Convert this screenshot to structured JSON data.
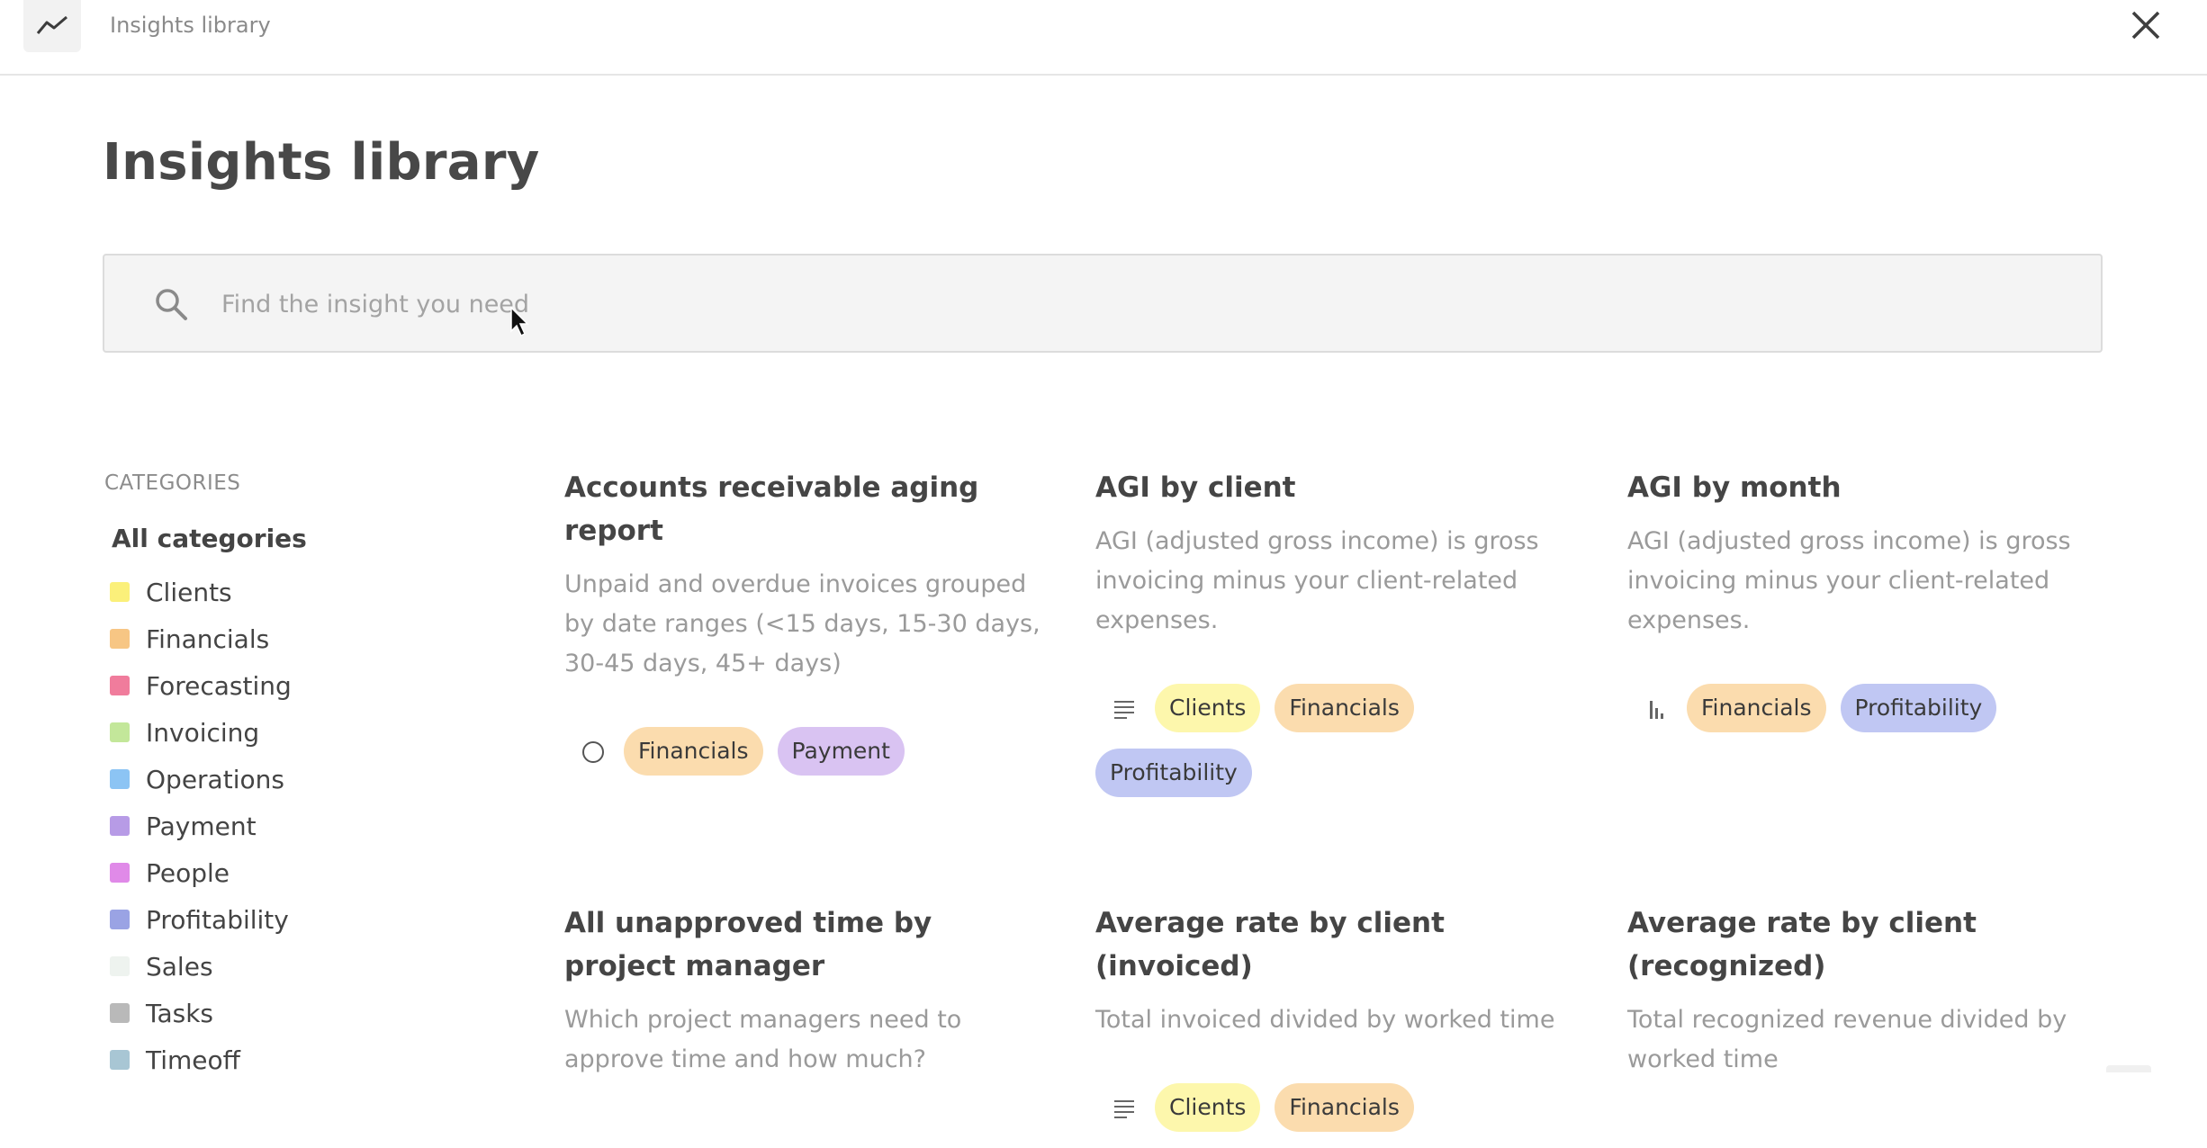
{
  "topbar": {
    "title": "Insights library",
    "app_icon": "trend-line-icon",
    "close_icon": "close-icon"
  },
  "page": {
    "title": "Insights library"
  },
  "search": {
    "placeholder": "Find the insight you need",
    "value": ""
  },
  "categories": {
    "heading": "CATEGORIES",
    "all_label": "All categories",
    "items": [
      {
        "label": "Clients",
        "color": "#fbf07a"
      },
      {
        "label": "Financials",
        "color": "#f7c684"
      },
      {
        "label": "Forecasting",
        "color": "#f07c9c"
      },
      {
        "label": "Invoicing",
        "color": "#c3e79a"
      },
      {
        "label": "Operations",
        "color": "#8cc4f4"
      },
      {
        "label": "Payment",
        "color": "#b79be6"
      },
      {
        "label": "People",
        "color": "#e08ae8"
      },
      {
        "label": "Profitability",
        "color": "#9aa3e4"
      },
      {
        "label": "Sales",
        "color": "#eef3ef"
      },
      {
        "label": "Tasks",
        "color": "#b9b9b9"
      },
      {
        "label": "Timeoff",
        "color": "#a8c6d4"
      }
    ]
  },
  "tag_colors": {
    "Clients": "#fdf7ac",
    "Financials": "#fbdcae",
    "Payment": "#d9c3f2",
    "Profitability": "#c0c7f3"
  },
  "cards": [
    {
      "title": "Accounts receivable aging report",
      "description": "Unpaid and overdue invoices grouped by date ranges (<15 days, 15-30 days, 30-45 days, 45+ days)",
      "type_icon": "pie-chart-icon",
      "tags": [
        "Financials",
        "Payment"
      ]
    },
    {
      "title": "AGI by client",
      "description": "AGI (adjusted gross income) is gross invoicing minus your client-related expenses.",
      "type_icon": "table-icon",
      "tags": [
        "Clients",
        "Financials",
        "Profitability"
      ]
    },
    {
      "title": "AGI by month",
      "description": "AGI (adjusted gross income) is gross invoicing minus your client-related expenses.",
      "type_icon": "bar-chart-icon",
      "tags": [
        "Financials",
        "Profitability"
      ]
    },
    {
      "title": "All unapproved time by project manager",
      "description": "Which project managers need to approve time and how much?",
      "type_icon": "",
      "tags": []
    },
    {
      "title": "Average rate by client (invoiced)",
      "description": "Total invoiced divided by worked time",
      "type_icon": "table-icon",
      "tags": [
        "Clients",
        "Financials"
      ]
    },
    {
      "title": "Average rate by client (recognized)",
      "description": "Total recognized revenue divided by worked time",
      "type_icon": "",
      "tags": []
    }
  ]
}
